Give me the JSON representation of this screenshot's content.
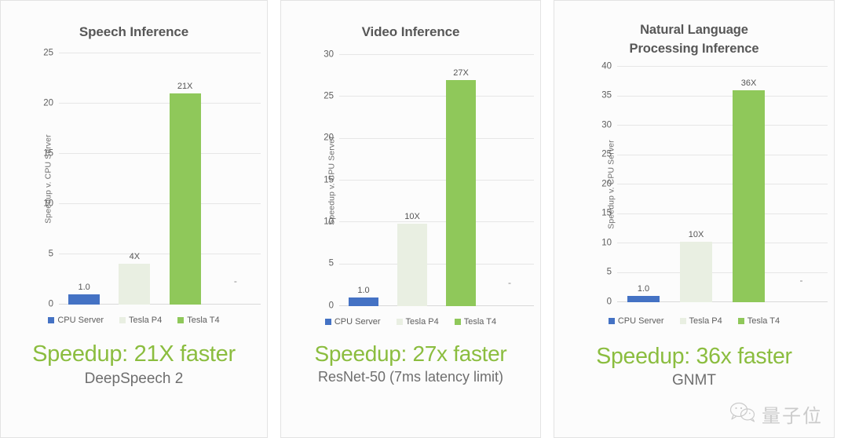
{
  "chart_data": [
    {
      "type": "bar",
      "title": "Speech Inference",
      "xlabel": "",
      "ylabel": "Speedup v. CPU Server",
      "ylim": [
        0,
        25
      ],
      "yticks": [
        0,
        5,
        10,
        15,
        20,
        25
      ],
      "grid": true,
      "legend_position": "bottom",
      "categories": [
        "CPU Server",
        "Tesla P4",
        "Tesla T4",
        ""
      ],
      "values": [
        1.0,
        4.0,
        21.0,
        null
      ],
      "data_labels": [
        "1.0",
        "4X",
        "21X",
        "-"
      ],
      "colors": [
        "#4472C4",
        "#E9EFE2",
        "#8FC85A",
        "transparent"
      ],
      "summary_headline": "Speedup: 21X faster",
      "summary_sub": "DeepSpeech 2"
    },
    {
      "type": "bar",
      "title": "Video Inference",
      "xlabel": "",
      "ylabel": "Speedup v. CPU Server",
      "ylim": [
        0,
        30
      ],
      "yticks": [
        0,
        5,
        10,
        15,
        20,
        25,
        30
      ],
      "grid": true,
      "legend_position": "bottom",
      "categories": [
        "CPU Server",
        "Tesla P4",
        "Tesla T4",
        ""
      ],
      "values": [
        1.0,
        9.8,
        27.0,
        null
      ],
      "data_labels": [
        "1.0",
        "10X",
        "27X",
        "-"
      ],
      "colors": [
        "#4472C4",
        "#E9EFE2",
        "#8FC85A",
        "transparent"
      ],
      "summary_headline": "Speedup: 27x faster",
      "summary_sub": "ResNet-50 (7ms latency limit)"
    },
    {
      "type": "bar",
      "title": "Natural Language Processing Inference",
      "title_lines": [
        "Natural Language",
        "Processing Inference"
      ],
      "xlabel": "",
      "ylabel": "Speedup v. CPU Server",
      "ylim": [
        0,
        40
      ],
      "yticks": [
        0,
        5,
        10,
        15,
        20,
        25,
        30,
        35,
        40
      ],
      "grid": true,
      "legend_position": "bottom",
      "categories": [
        "CPU Server",
        "Tesla P4",
        "Tesla T4",
        ""
      ],
      "values": [
        1.0,
        10.3,
        36.0,
        null
      ],
      "data_labels": [
        "1.0",
        "10X",
        "36X",
        "-"
      ],
      "colors": [
        "#4472C4",
        "#E9EFE2",
        "#8FC85A",
        "transparent"
      ],
      "summary_headline": "Speedup: 36x faster",
      "summary_sub": "GNMT"
    }
  ],
  "legend": {
    "items": [
      {
        "label": "CPU Server",
        "color": "#4472C4"
      },
      {
        "label": "Tesla P4",
        "color": "#E9EFE2"
      },
      {
        "label": "Tesla T4",
        "color": "#8FC85A"
      }
    ]
  },
  "theme": {
    "accent_green": "#8bbd3f",
    "bar_green": "#8FC85A",
    "bar_blue": "#4472C4",
    "bar_pale": "#E9EFE2",
    "title_color": "#575757",
    "grid_color": "#e6e6e6"
  },
  "watermark": {
    "icon": "wechat-icon",
    "text": "量子位"
  }
}
